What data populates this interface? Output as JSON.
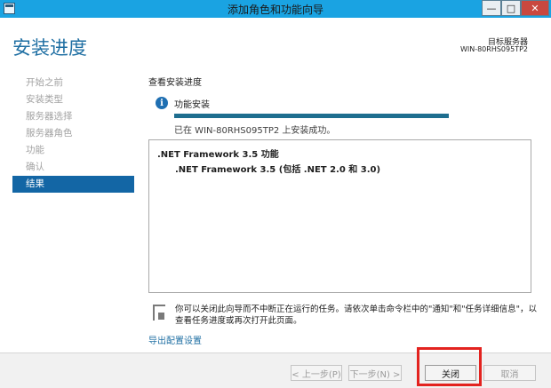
{
  "window": {
    "title": "添加角色和功能向导",
    "controls": {
      "minimize": "—",
      "maximize": "□",
      "close": "✕"
    }
  },
  "header": {
    "title": "安装进度",
    "target_label": "目标服务器",
    "target_server": "WIN-80RHS095TP2"
  },
  "sidebar": {
    "items": [
      {
        "label": "开始之前",
        "active": false
      },
      {
        "label": "安装类型",
        "active": false
      },
      {
        "label": "服务器选择",
        "active": false
      },
      {
        "label": "服务器角色",
        "active": false
      },
      {
        "label": "功能",
        "active": false
      },
      {
        "label": "确认",
        "active": false
      },
      {
        "label": "结果",
        "active": true
      }
    ]
  },
  "main": {
    "section_label": "查看安装进度",
    "install": {
      "icon": "info-icon",
      "label": "功能安装",
      "progress": 1.0,
      "status": "已在 WIN-80RHS095TP2 上安装成功。"
    },
    "results": [
      ".NET Framework 3.5 功能",
      ".NET Framework 3.5 (包括 .NET 2.0 和 3.0)"
    ],
    "note": "你可以关闭此向导而不中断正在运行的任务。请依次单击命令栏中的\"通知\"和\"任务详细信息\"，以查看任务进度或再次打开此页面。",
    "export_link": "导出配置设置"
  },
  "footer": {
    "prev": "< 上一步(P)",
    "next": "下一步(N) >",
    "close": "关闭",
    "cancel": "取消"
  },
  "colors": {
    "titlebar": "#1aa3e2",
    "accent": "#1366a5",
    "progress": "#1e6e8f",
    "highlight": "#e3231f"
  }
}
